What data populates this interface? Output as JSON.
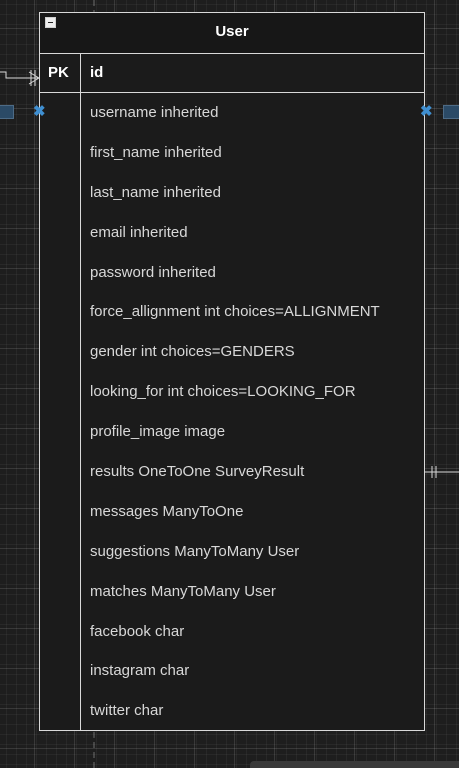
{
  "entity": {
    "title": "User",
    "primary_key": {
      "label": "PK",
      "field": "id"
    },
    "attributes": [
      "username inherited",
      "first_name inherited",
      "last_name inherited",
      "email inherited",
      "password inherited",
      "force_allignment int choices=ALLIGNMENT",
      "gender int choices=GENDERS",
      "looking_for int choices=LOOKING_FOR",
      "profile_image image",
      "results OneToOne SurveyResult",
      "messages ManyToOne",
      "suggestions ManyToMany User",
      "matches ManyToMany User",
      "facebook char",
      "instagram char",
      "twitter char"
    ]
  },
  "colors": {
    "canvas": "#1e1e1e",
    "entity_border": "#d9d9d9",
    "connector_marker": "#3f8fd1"
  }
}
